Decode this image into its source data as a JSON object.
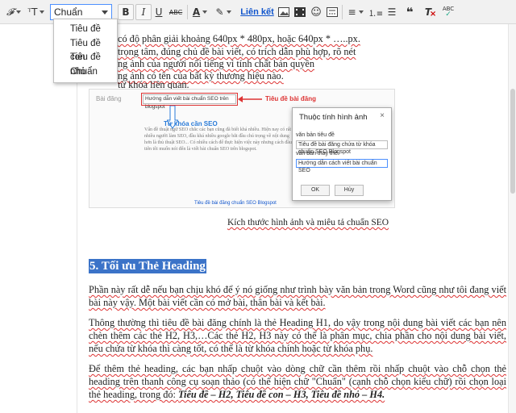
{
  "toolbar": {
    "font_icon": "𝓕",
    "size_icon": "ᵀT",
    "format_value": "Chuẩn",
    "bold": "B",
    "italic": "I",
    "underline": "U",
    "strike": "ABC",
    "text_color": "A",
    "link": "Liên kết",
    "quote": "❝",
    "clear": "T",
    "spell": "ABC"
  },
  "format_dropdown": {
    "items": [
      "Tiêu đề",
      "Tiêu đề con",
      "Tiêu đề nhỏ",
      "Chuẩn"
    ]
  },
  "editor": {
    "top_lines": [
      "có độ phân giải khoảng 640px * 480px, hoặc 640px * …..px.",
      "trọng tâm, đúng chủ đề bài viết, có trích dẫn phù hợp, rõ nét",
      "ng ảnh của người nổi tiếng vì tính chất bản quyền",
      "ng ảnh có tên của bất kỳ thương hiệu nào.",
      "từ khóa liên quan."
    ],
    "image_caption": "Kích thước hình ảnh và miêu tả chuẩn SEO",
    "heading": "5. Tối ưu Thẻ Heading",
    "para1": "Phần này rất dễ nếu bạn chịu khó để ý nó giống như trình bày văn bản trong Word cũng như tôi đang viết bài này vậy. Một bài viết cần có mở bài, thân bài và kết bài.",
    "para2": "Thông thường thì tiêu đề bài đăng chính là thẻ Heading H1, do vậy trong nội dung bài viết các bạn nên chèn thêm các thẻ H2, H3,…Các thẻ H2, H3 này có thể là phân mục, chia phần cho nội dung bài viết, nếu chứa từ khóa thì càng tốt, có thể là từ khóa chính hoặc từ khóa phụ.",
    "para3_a": "Để thêm thẻ heading, các bạn nhấp chuột vào dòng chữ cần thêm rồi nhấp chuột vào chỗ chọn thẻ heading trên thanh công cụ soạn thảo (có thể hiện chữ \"Chuẩn\" (cạnh chỗ chọn kiểu chữ) rồi chọn loại thẻ heading, trong đó: ",
    "para3_b": "Tiêu đề – H2, Tiêu đề con – H3, Tiêu đề nhỏ – H4."
  },
  "figure": {
    "post_label": "Bài đăng",
    "post_input": "Hướng dẫn viết bài chuẩn SEO trên blogspot",
    "title_note": "Tiêu đề bài đăng",
    "keyword_note": "Từ khóa cần SEO",
    "body_text": "Vấn đề thuật ngữ SEO chắc các bạn cũng đã biết khá nhiều. Hiện nay có rất nhiều người làm SEO, đầu khá nhiều google bắt đầu chú trọng về nội dung hơn là thủ thuật SEO... Có nhiều cách để thực hiện việc này nhưng cách đầu tiên tôi muốn nói đến là viết bài chuẩn SEO trên blogspot.",
    "caption": "Tiêu đề bài đăng chuẩn SEO Blogspot",
    "dialog": {
      "title": "Thuộc tính hình ảnh",
      "close": "×",
      "label1": "văn bản tiêu đề",
      "value1": "Tiêu đề bài đăng chứa từ khóa chuẩn SEO Blogspot",
      "label2": "văn bản thay thế",
      "value2": "Hướng dẫn cách viết bài chuẩn SEO",
      "ok": "OK",
      "cancel": "Hủy"
    }
  },
  "colors": {
    "accent": "#4d90fe",
    "heading_bg": "#3b73c8",
    "link": "#1155cc",
    "annotation": "#dd3333"
  }
}
